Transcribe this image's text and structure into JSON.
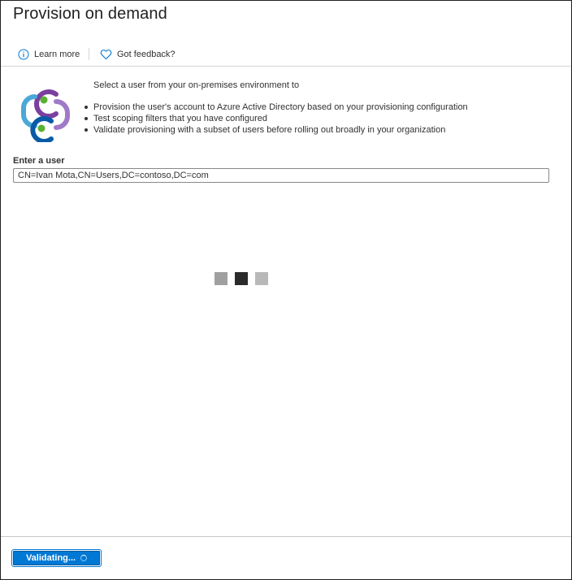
{
  "page": {
    "title": "Provision on demand"
  },
  "toolbar": {
    "learn_more_label": "Learn more",
    "feedback_label": "Got feedback?"
  },
  "intro": {
    "heading": "Select a user from your on-premises environment to",
    "bullets": [
      "Provision the user's account to Azure Active Directory based on your provisioning configuration",
      "Test scoping filters that you have configured",
      "Validate provisioning with a subset of users before rolling out broadly in your organization"
    ]
  },
  "user_field": {
    "label": "Enter a user",
    "value": "CN=Ivan Mota,CN=Users,DC=contoso,DC=com"
  },
  "loading": {
    "colors": [
      "#a0a0a0",
      "#2b2b2b",
      "#b8b8b8"
    ]
  },
  "footer": {
    "validate_label": "Validating..."
  },
  "colors": {
    "accent": "#0078d4",
    "logo_purple": "#7b3fa0",
    "logo_teal": "#4aa8d8",
    "logo_blue": "#0a5aa8",
    "logo_green": "#5ab031"
  },
  "icons": {
    "learn_more": "info-icon",
    "feedback": "heart-icon",
    "logo": "provisioning-sync-logo"
  }
}
